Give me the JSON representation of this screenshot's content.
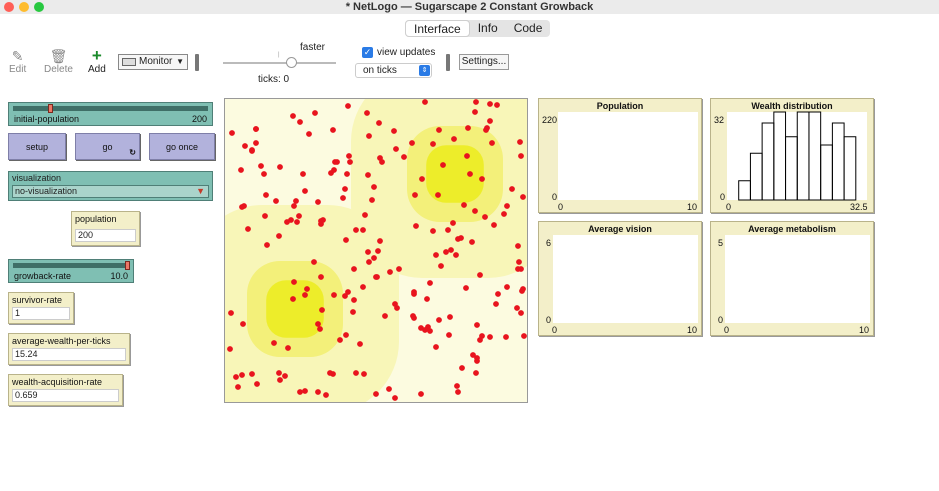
{
  "window": {
    "title": "* NetLogo — Sugarscape 2 Constant Growback"
  },
  "tabs": [
    {
      "label": "Interface",
      "active": true
    },
    {
      "label": "Info",
      "active": false
    },
    {
      "label": "Code",
      "active": false
    }
  ],
  "toolbar": {
    "edit_label": "Edit",
    "delete_label": "Delete",
    "add_label": "Add",
    "widget_type": "Monitor",
    "speed_label": "faster",
    "ticks_label": "ticks: 0",
    "view_updates_label": "view updates",
    "view_updates_checked": true,
    "update_mode": "on ticks",
    "settings_label": "Settings..."
  },
  "widgets": {
    "initial_population": {
      "label": "initial-population",
      "value": "200",
      "level": 0.2
    },
    "setup_label": "setup",
    "go_label": "go",
    "go_once_label": "go once",
    "visualization": {
      "label": "visualization",
      "value": "no-visualization"
    },
    "population_monitor": {
      "label": "population",
      "value": "200"
    },
    "growback_rate": {
      "label": "growback-rate",
      "value": "10.0",
      "level": 1.0
    },
    "survivor_rate": {
      "label": "survivor-rate",
      "value": "1"
    },
    "average_wealth": {
      "label": "average-wealth-per-ticks",
      "value": "15.24"
    },
    "wealth_acquisition": {
      "label": "wealth-acquisition-rate",
      "value": "0.659"
    }
  },
  "plots": {
    "population": {
      "title": "Population",
      "ymax": "220",
      "ymin": "0",
      "xmin": "0",
      "xmax": "10"
    },
    "wealth": {
      "title": "Wealth distribution",
      "ymax": "32",
      "ymin": "0",
      "xmin": "0",
      "xmax": "32.5"
    },
    "vision": {
      "title": "Average vision",
      "ymax": "6",
      "ymin": "0",
      "xmin": "0",
      "xmax": "10"
    },
    "metabolism": {
      "title": "Average metabolism",
      "ymax": "5",
      "ymin": "0",
      "xmin": "0",
      "xmax": "10"
    }
  },
  "chart_data": {
    "type": "bar",
    "title": "Wealth distribution",
    "xlim": [
      0,
      32.5
    ],
    "ylim": [
      0,
      32
    ],
    "values": [
      0,
      7,
      17,
      28,
      34,
      23,
      33,
      32,
      20,
      28,
      23
    ]
  },
  "colors": {
    "agent": "#e8141e",
    "sugar_high": "#eded2a",
    "sugar_mid": "#f3f07a",
    "sugar_low": "#f8f6b8",
    "sugar_faint": "#fcfbe0"
  }
}
